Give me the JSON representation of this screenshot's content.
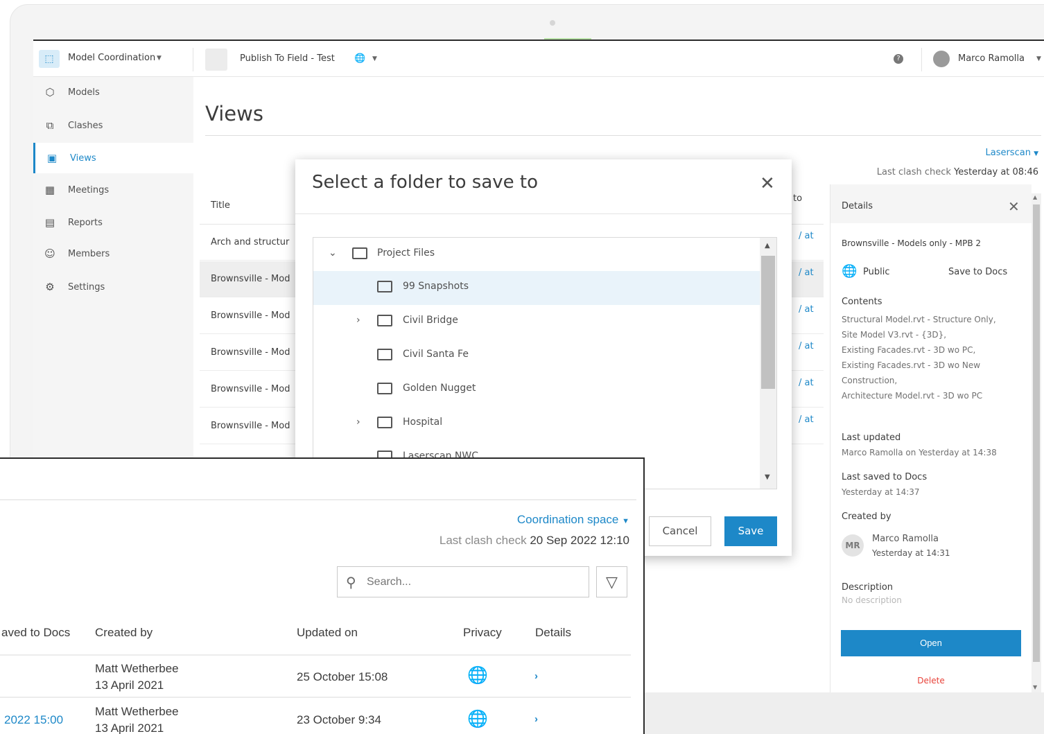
{
  "app": {
    "module_title": "Model Coordination",
    "project_title": "Publish To Field - Test",
    "user_name": "Marco Ramolla"
  },
  "sidebar": {
    "items": [
      {
        "label": "Models",
        "icon": "cube-icon"
      },
      {
        "label": "Clashes",
        "icon": "clash-icon"
      },
      {
        "label": "Views",
        "icon": "views-icon"
      },
      {
        "label": "Meetings",
        "icon": "calendar-icon"
      },
      {
        "label": "Reports",
        "icon": "report-icon"
      },
      {
        "label": "Members",
        "icon": "members-icon"
      },
      {
        "label": "Settings",
        "icon": "gear-icon"
      }
    ],
    "active": "Views"
  },
  "main": {
    "page_title": "Views",
    "space_selector": "Laserscan",
    "last_clash_label": "Last clash check",
    "last_clash_value": "Yesterday at 08:46",
    "table": {
      "column_title": "Title",
      "column_partial": "to",
      "rows": [
        {
          "title": "Arch and structur",
          "partial": "/ at"
        },
        {
          "title": "Brownsville - Mod",
          "partial": "/ at"
        },
        {
          "title": "Brownsville - Mod",
          "partial": "/ at"
        },
        {
          "title": "Brownsville - Mod",
          "partial": "/ at"
        },
        {
          "title": "Brownsville - Mod",
          "partial": "/ at"
        },
        {
          "title": "Brownsville - Mod",
          "partial": "/ at"
        }
      ]
    }
  },
  "details": {
    "header": "Details",
    "name": "Brownsville - Models only - MPB 2",
    "privacy": "Public",
    "save_to_docs": "Save to Docs",
    "contents_label": "Contents",
    "contents": [
      "Structural Model.rvt - Structure Only,",
      "Site Model V3.rvt - {3D},",
      "Existing Facades.rvt - 3D wo PC,",
      "Existing Facades.rvt - 3D wo New Construction,",
      "Architecture Model.rvt - 3D wo PC"
    ],
    "last_updated_label": "Last updated",
    "last_updated_value": "Marco Ramolla on Yesterday at 14:38",
    "last_saved_label": "Last saved to Docs",
    "last_saved_value": "Yesterday at 14:37",
    "created_by_label": "Created by",
    "creator_initials": "MR",
    "creator_name": "Marco Ramolla",
    "creator_date": "Yesterday at 14:31",
    "description_label": "Description",
    "description_value": "No description",
    "open_label": "Open",
    "delete_label": "Delete"
  },
  "modal": {
    "title": "Select a folder to save to",
    "folders": [
      {
        "label": "Project Files",
        "expanded": true
      },
      {
        "label": "99 Snapshots",
        "selected": true
      },
      {
        "label": "Civil Bridge",
        "expandable": true
      },
      {
        "label": "Civil Santa Fe"
      },
      {
        "label": "Golden Nugget"
      },
      {
        "label": "Hospital",
        "expandable": true
      },
      {
        "label": "Laserscan NWC"
      }
    ],
    "cancel_label": "Cancel",
    "save_label": "Save"
  },
  "overlay": {
    "space_selector": "Coordination space",
    "last_clash_label": "Last clash check",
    "last_clash_value": "20 Sep 2022 12:10",
    "search_placeholder": "Search...",
    "columns": {
      "saved": "aved to Docs",
      "created_by": "Created by",
      "updated_on": "Updated on",
      "privacy": "Privacy",
      "details": "Details"
    },
    "rows": [
      {
        "saved": "",
        "creator": "Matt Wetherbee",
        "created": "13 April 2021",
        "updated": "25 October 15:08"
      },
      {
        "saved": "2022  15:00",
        "creator": "Matt Wetherbee",
        "created": "13 April 2021",
        "updated": "23 October 9:34"
      }
    ]
  },
  "colors": {
    "accent": "#1d88c8",
    "delete": "#e8433a"
  }
}
